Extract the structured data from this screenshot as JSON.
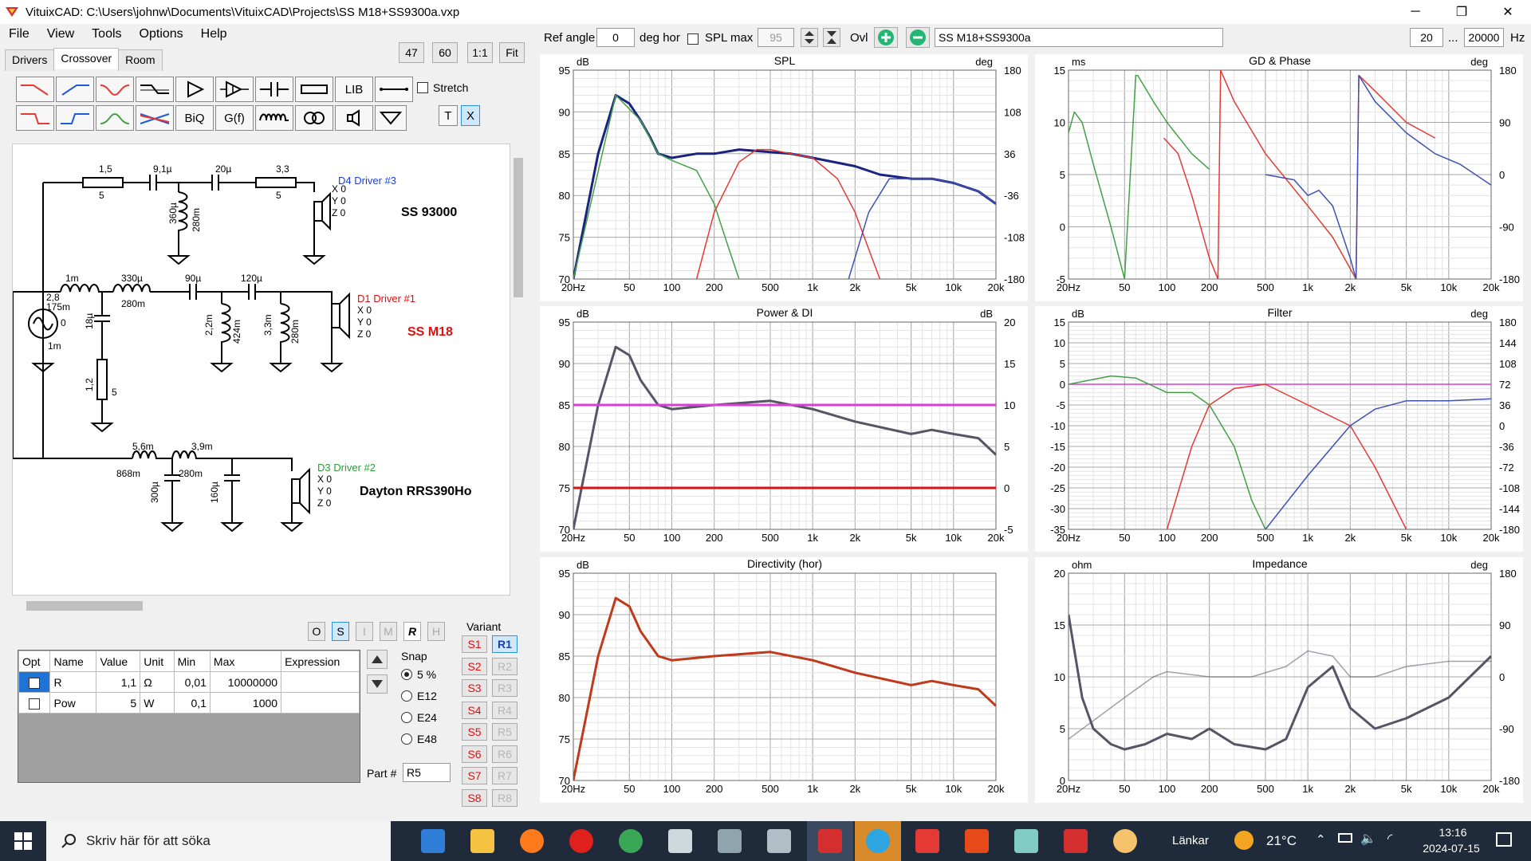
{
  "window": {
    "title": "VituixCAD: C:\\Users\\johnw\\Documents\\VituixCAD\\Projects\\SS M18+SS9300a.vxp",
    "controls": [
      "─",
      "❐",
      "✕"
    ]
  },
  "menu": [
    "File",
    "View",
    "Tools",
    "Options",
    "Help"
  ],
  "tabs": [
    "Drivers",
    "Crossover",
    "Room"
  ],
  "zoom_buttons": [
    "47",
    "60",
    "1:1",
    "Fit"
  ],
  "toolbox": {
    "row1": [
      "",
      "",
      "",
      "",
      "",
      "",
      "",
      "",
      "LIB",
      ""
    ],
    "row2": [
      "",
      "",
      "",
      "",
      "BiQ",
      "G(f)",
      "",
      "",
      "",
      "",
      "T",
      "X"
    ],
    "stretch_label": "Stretch"
  },
  "schematic": {
    "branches": [
      {
        "driver": "D4 Driver #3",
        "name": "SS 93000",
        "xyz": [
          "X 0",
          "Y 0",
          "Z 0"
        ],
        "parts": [
          "1,5",
          "5",
          "9,1µ",
          "20µ",
          "3,3",
          "5",
          "360µ",
          "280m"
        ]
      },
      {
        "driver": "D1 Driver #1",
        "name": "SS M18",
        "xyz": [
          "X 0",
          "Y 0",
          "Z 0"
        ],
        "parts": [
          "1m",
          "330µ",
          "280m",
          "90µ",
          "120µ",
          "18µ",
          "2,2m",
          "424m",
          "3,3m",
          "280m",
          "1,2",
          "5",
          "2,8",
          "175m",
          "0",
          "1m"
        ]
      },
      {
        "driver": "D3 Driver #2",
        "name": "Dayton RRS390Ho",
        "xyz": [
          "X 0",
          "Y 0",
          "Z 0"
        ],
        "parts": [
          "5,6m",
          "868m",
          "3,9m",
          "280m",
          "300µ",
          "160µ"
        ]
      }
    ]
  },
  "view_buttons": [
    "O",
    "S",
    "I",
    "M",
    "R",
    "H"
  ],
  "part_table": {
    "headers": [
      "Opt",
      "Name",
      "Value",
      "Unit",
      "Min",
      "Max",
      "Expression"
    ],
    "rows": [
      {
        "name": "R",
        "value": "1,1",
        "unit": "Ω",
        "min": "0,01",
        "max": "10000000",
        "expression": ""
      },
      {
        "name": "Pow",
        "value": "5",
        "unit": "W",
        "min": "0,1",
        "max": "1000",
        "expression": ""
      }
    ]
  },
  "snap": {
    "label": "Snap",
    "options": [
      "5 %",
      "E12",
      "E24",
      "E48"
    ],
    "selected": "5 %"
  },
  "part_number": {
    "label": "Part #",
    "value": "R5"
  },
  "variant": {
    "label": "Variant",
    "s": [
      "S1",
      "S2",
      "S3",
      "S4",
      "S5",
      "S6",
      "S7",
      "S8"
    ],
    "r": [
      "R1",
      "R2",
      "R3",
      "R4",
      "R5",
      "R6",
      "R7",
      "R8"
    ],
    "active": "R1"
  },
  "top_controls": {
    "ref_angle_label": "Ref angle",
    "ref_angle_value": "0",
    "deg_hor": "deg hor",
    "spl_max_label": "SPL max",
    "spl_max_value": "95",
    "ovl_label": "Ovl",
    "project_name": "SS M18+SS9300a",
    "f_min": "20",
    "f_max": "20000",
    "hz": "Hz",
    "ellipsis": "..."
  },
  "freq_ticks": [
    "20Hz",
    "50",
    "100",
    "200",
    "500",
    "1k",
    "2k",
    "5k",
    "10k",
    "20k"
  ],
  "colors": {
    "total": "#1a237e",
    "tweeter": "#e53935",
    "mid": "#3f51b5",
    "woofer": "#43a047",
    "grey": "#555566",
    "magenta": "#d63fd6",
    "red": "#e01010",
    "directivity": "#c0391b"
  },
  "chart_data": [
    {
      "type": "line",
      "title": "SPL",
      "ylabel_left": "dB",
      "ylabel_right": "deg",
      "ylim": [
        70,
        95
      ],
      "yticks_left": [
        "95",
        "90",
        "85",
        "80",
        "75",
        "70"
      ],
      "yticks_right": [
        "180",
        "108",
        "36",
        "-36",
        "-108",
        "-180"
      ],
      "series": [
        {
          "color": "total",
          "x": [
            20,
            30,
            40,
            50,
            60,
            70,
            80,
            100,
            150,
            200,
            300,
            500,
            700,
            1000,
            2000,
            3000,
            5000,
            7000,
            10000,
            15000,
            20000
          ],
          "y": [
            70,
            85,
            92,
            91,
            89,
            87,
            85,
            84.5,
            85,
            85,
            85.5,
            85.2,
            85,
            84.5,
            83.5,
            82.5,
            82,
            82,
            81.5,
            80.5,
            79
          ]
        },
        {
          "color": "woofer",
          "x": [
            20,
            40,
            60,
            80,
            100,
            150,
            200,
            250,
            300
          ],
          "y": [
            70,
            92,
            89,
            85,
            84.2,
            83,
            79,
            74,
            70
          ]
        },
        {
          "color": "tweeter",
          "x": [
            150,
            200,
            300,
            400,
            500,
            700,
            1000,
            1500,
            2000,
            3000
          ],
          "y": [
            70,
            78,
            84,
            85.5,
            85.5,
            85,
            84.5,
            82,
            78,
            70
          ]
        },
        {
          "color": "mid",
          "x": [
            1800,
            2500,
            3500,
            5000,
            7000,
            10000,
            15000,
            20000
          ],
          "y": [
            70,
            78,
            82,
            82,
            82,
            81.5,
            80.5,
            79
          ]
        }
      ]
    },
    {
      "type": "line",
      "title": "GD & Phase",
      "ylabel_left": "ms",
      "ylabel_right": "deg",
      "ylim": [
        -5,
        15
      ],
      "yticks_left": [
        "15",
        "10",
        "5",
        "0",
        "-5"
      ],
      "yticks_right": [
        "180",
        "90",
        "0",
        "-90",
        "-180"
      ],
      "series": [
        {
          "color": "woofer",
          "x": [
            20,
            22,
            25,
            30,
            40,
            50,
            60,
            62,
            80,
            100,
            150,
            200
          ],
          "y": [
            9,
            11,
            10,
            6,
            0,
            -5,
            14.5,
            14.5,
            12,
            10,
            7,
            5.5
          ]
        },
        {
          "color": "tweeter",
          "x": [
            95,
            120,
            150,
            200,
            230,
            240,
            300,
            500,
            1000,
            1500,
            2200,
            2300,
            3000,
            5000,
            8000
          ],
          "y": [
            8.5,
            7,
            3,
            -3,
            -5,
            15,
            12,
            7,
            2,
            -1,
            -5,
            14.5,
            13,
            10,
            8.5
          ]
        },
        {
          "color": "mid",
          "x": [
            500,
            800,
            1000,
            1200,
            1500,
            2000,
            2200,
            2300,
            3000,
            5000,
            8000,
            12000,
            20000
          ],
          "y": [
            5,
            4.5,
            3,
            3.5,
            2,
            -3,
            -5,
            14.5,
            12,
            9,
            7,
            6,
            4
          ]
        }
      ]
    },
    {
      "type": "line",
      "title": "Power & DI",
      "ylabel_left": "dB",
      "ylabel_right": "dB",
      "ylim": [
        70,
        95
      ],
      "yticks_left": [
        "95",
        "90",
        "85",
        "80",
        "75",
        "70"
      ],
      "yticks_right": [
        "20",
        "15",
        "10",
        "5",
        "0",
        "-5"
      ],
      "series": [
        {
          "color": "grey",
          "x": [
            20,
            30,
            40,
            50,
            60,
            80,
            100,
            200,
            500,
            1000,
            2000,
            5000,
            7000,
            10000,
            15000,
            20000
          ],
          "y": [
            70,
            85,
            92,
            91,
            88,
            85,
            84.5,
            85,
            85.5,
            84.5,
            83,
            81.5,
            82,
            81.5,
            81,
            79
          ]
        },
        {
          "color": "magenta",
          "x": [
            20,
            20000
          ],
          "y": [
            85,
            85
          ]
        },
        {
          "color": "red",
          "x": [
            20,
            20000
          ],
          "y": [
            75,
            75
          ]
        }
      ]
    },
    {
      "type": "line",
      "title": "Filter",
      "ylabel_left": "dB",
      "ylabel_right": "deg",
      "ylim": [
        -35,
        15
      ],
      "yticks_left": [
        "15",
        "10",
        "5",
        "0",
        "-5",
        "-10",
        "-15",
        "-20",
        "-25",
        "-30",
        "-35"
      ],
      "yticks_right": [
        "180",
        "144",
        "108",
        "72",
        "36",
        "0",
        "-36",
        "-72",
        "-108",
        "-144",
        "-180"
      ],
      "series": [
        {
          "color": "magenta",
          "x": [
            20,
            20000
          ],
          "y": [
            0,
            0
          ]
        },
        {
          "color": "woofer",
          "x": [
            20,
            40,
            60,
            100,
            150,
            200,
            300,
            400,
            500
          ],
          "y": [
            0,
            2,
            1.5,
            -2,
            -2,
            -5,
            -15,
            -28,
            -35
          ]
        },
        {
          "color": "tweeter",
          "x": [
            100,
            150,
            200,
            300,
            500,
            1000,
            2000,
            3000,
            5000
          ],
          "y": [
            -35,
            -15,
            -5,
            -1,
            0,
            -5,
            -10,
            -20,
            -35
          ]
        },
        {
          "color": "mid",
          "x": [
            500,
            1000,
            2000,
            3000,
            5000,
            10000,
            20000
          ],
          "y": [
            -35,
            -22,
            -10,
            -6,
            -4,
            -4,
            -3.5
          ]
        }
      ]
    },
    {
      "type": "line",
      "title": "Directivity (hor)",
      "ylabel_left": "dB",
      "ylim": [
        70,
        95
      ],
      "yticks_left": [
        "95",
        "90",
        "85",
        "80",
        "75",
        "70"
      ],
      "series": [
        {
          "color": "directivity",
          "x": [
            20,
            30,
            40,
            50,
            60,
            80,
            100,
            200,
            500,
            1000,
            2000,
            5000,
            7000,
            10000,
            15000,
            20000
          ],
          "y": [
            70,
            85,
            92,
            91,
            88,
            85,
            84.5,
            85,
            85.5,
            84.5,
            83,
            81.5,
            82,
            81.5,
            81,
            79
          ]
        }
      ]
    },
    {
      "type": "line",
      "title": "Impedance",
      "ylabel_left": "ohm",
      "ylabel_right": "deg",
      "ylim": [
        0,
        20
      ],
      "yticks_left": [
        "20",
        "15",
        "10",
        "5",
        "0"
      ],
      "yticks_right": [
        "180",
        "90",
        "0",
        "-90",
        "-180"
      ],
      "series": [
        {
          "color": "grey",
          "x": [
            20,
            25,
            30,
            40,
            50,
            70,
            100,
            150,
            200,
            300,
            500,
            700,
            1000,
            1500,
            2000,
            3000,
            5000,
            10000,
            20000
          ],
          "y": [
            16,
            8,
            5,
            3.5,
            3,
            3.5,
            4.5,
            4,
            5,
            3.5,
            3,
            4,
            9,
            11,
            7,
            5,
            6,
            8,
            12
          ]
        },
        {
          "color": "grey",
          "x": [
            20,
            50,
            80,
            100,
            200,
            400,
            700,
            1000,
            1500,
            2000,
            3000,
            5000,
            10000,
            20000
          ],
          "y": [
            4,
            8,
            10,
            10.5,
            10,
            10,
            11,
            12.5,
            12,
            10,
            10,
            11,
            11.5,
            11.5
          ]
        }
      ]
    }
  ],
  "taskbar": {
    "search_placeholder": "Skriv här för att söka",
    "links_label": "Länkar",
    "temperature": "21°C",
    "time": "13:16",
    "date": "2024-07-15"
  }
}
